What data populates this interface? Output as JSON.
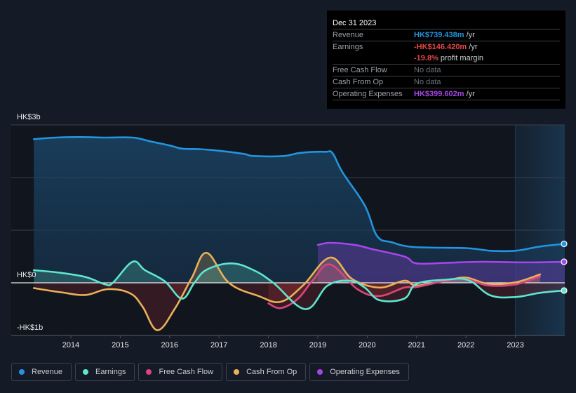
{
  "tooltip": {
    "date": "Dec 31 2023",
    "rows": [
      {
        "label": "Revenue",
        "value": "HK$739.438m",
        "suffix": " /yr",
        "color": "#2394df"
      },
      {
        "label": "Earnings",
        "value": "-HK$146.420m",
        "suffix": " /yr",
        "color": "#e64747"
      },
      {
        "label": "",
        "value": "-19.8%",
        "suffix": " profit margin",
        "color": "#e64747"
      },
      {
        "label": "Free Cash Flow",
        "value": "No data",
        "suffix": "",
        "color": ""
      },
      {
        "label": "Cash From Op",
        "value": "No data",
        "suffix": "",
        "color": ""
      },
      {
        "label": "Operating Expenses",
        "value": "HK$399.602m",
        "suffix": " /yr",
        "color": "#a646e8"
      }
    ]
  },
  "legend": [
    {
      "label": "Revenue",
      "color": "#2394df"
    },
    {
      "label": "Earnings",
      "color": "#5ee6cf"
    },
    {
      "label": "Free Cash Flow",
      "color": "#d8457f"
    },
    {
      "label": "Cash From Op",
      "color": "#eab05a"
    },
    {
      "label": "Operating Expenses",
      "color": "#a646e8"
    }
  ],
  "chart_data": {
    "type": "line",
    "title": "",
    "xlabel": "",
    "ylabel": "",
    "currency": "HK$",
    "y_unit": "billions",
    "ylim": [
      -1,
      3
    ],
    "y_ticks": [
      {
        "value": 3,
        "label": "HK$3b"
      },
      {
        "value": 0,
        "label": "HK$0"
      },
      {
        "value": -1,
        "label": "-HK$1b"
      }
    ],
    "y_gridlines": [
      3,
      2,
      1,
      0
    ],
    "xlim": [
      2012.35,
      2024.0
    ],
    "x_ticks": [
      "2014",
      "2015",
      "2016",
      "2017",
      "2018",
      "2019",
      "2020",
      "2021",
      "2022",
      "2023"
    ],
    "highlight_region": [
      2023.0,
      2024.0
    ],
    "legend_position": "bottom-left",
    "series": [
      {
        "name": "Revenue",
        "color": "#2394df",
        "fill": "area",
        "end_marker": true,
        "points": [
          [
            2013.25,
            2.73
          ],
          [
            2013.7,
            2.76
          ],
          [
            2014.2,
            2.77
          ],
          [
            2014.7,
            2.76
          ],
          [
            2015.25,
            2.76
          ],
          [
            2015.6,
            2.69
          ],
          [
            2016.0,
            2.61
          ],
          [
            2016.25,
            2.55
          ],
          [
            2016.6,
            2.54
          ],
          [
            2017.0,
            2.51
          ],
          [
            2017.5,
            2.45
          ],
          [
            2017.7,
            2.41
          ],
          [
            2018.3,
            2.41
          ],
          [
            2018.65,
            2.47
          ],
          [
            2019.15,
            2.49
          ],
          [
            2019.3,
            2.46
          ],
          [
            2019.5,
            2.1
          ],
          [
            2019.95,
            1.47
          ],
          [
            2020.2,
            0.89
          ],
          [
            2020.5,
            0.77
          ],
          [
            2020.95,
            0.68
          ],
          [
            2022.0,
            0.66
          ],
          [
            2022.5,
            0.61
          ],
          [
            2023.0,
            0.61
          ],
          [
            2023.5,
            0.69
          ],
          [
            2024.0,
            0.74
          ]
        ]
      },
      {
        "name": "Earnings",
        "color": "#5ee6cf",
        "fill": "zero",
        "end_marker": true,
        "points": [
          [
            2013.25,
            0.24
          ],
          [
            2013.8,
            0.19
          ],
          [
            2014.3,
            0.11
          ],
          [
            2014.7,
            -0.03
          ],
          [
            2014.85,
            0.0
          ],
          [
            2015.25,
            0.4
          ],
          [
            2015.5,
            0.24
          ],
          [
            2015.9,
            0.03
          ],
          [
            2016.25,
            -0.3
          ],
          [
            2016.5,
            0.0
          ],
          [
            2016.75,
            0.25
          ],
          [
            2017.25,
            0.37
          ],
          [
            2017.7,
            0.24
          ],
          [
            2018.1,
            0.0
          ],
          [
            2018.75,
            -0.5
          ],
          [
            2019.2,
            -0.05
          ],
          [
            2019.65,
            0.04
          ],
          [
            2019.95,
            -0.09
          ],
          [
            2020.25,
            -0.33
          ],
          [
            2020.75,
            -0.3
          ],
          [
            2021.0,
            -0.02
          ],
          [
            2021.6,
            0.06
          ],
          [
            2022.05,
            0.05
          ],
          [
            2022.5,
            -0.24
          ],
          [
            2023.0,
            -0.27
          ],
          [
            2023.5,
            -0.19
          ],
          [
            2024.0,
            -0.146
          ]
        ]
      },
      {
        "name": "Free Cash Flow",
        "color": "#d8457f",
        "fill": "zero",
        "end_marker": false,
        "points": [
          [
            2018.0,
            -0.39
          ],
          [
            2018.25,
            -0.48
          ],
          [
            2018.6,
            -0.3
          ],
          [
            2018.9,
            0.05
          ],
          [
            2019.25,
            0.35
          ],
          [
            2019.8,
            -0.12
          ],
          [
            2020.25,
            -0.25
          ],
          [
            2020.75,
            -0.09
          ],
          [
            2021.0,
            -0.08
          ],
          [
            2021.6,
            0.04
          ],
          [
            2022.0,
            0.07
          ],
          [
            2022.45,
            -0.05
          ],
          [
            2023.0,
            -0.03
          ],
          [
            2023.5,
            0.12
          ]
        ]
      },
      {
        "name": "Cash From Op",
        "color": "#eab05a",
        "fill": "zero",
        "end_marker": false,
        "points": [
          [
            2013.25,
            -0.1
          ],
          [
            2013.8,
            -0.18
          ],
          [
            2014.3,
            -0.23
          ],
          [
            2014.75,
            -0.12
          ],
          [
            2015.2,
            -0.2
          ],
          [
            2015.45,
            -0.45
          ],
          [
            2015.75,
            -0.9
          ],
          [
            2016.1,
            -0.5
          ],
          [
            2016.45,
            0.1
          ],
          [
            2016.75,
            0.57
          ],
          [
            2017.2,
            0.0
          ],
          [
            2017.8,
            -0.25
          ],
          [
            2018.25,
            -0.36
          ],
          [
            2018.7,
            -0.05
          ],
          [
            2019.25,
            0.48
          ],
          [
            2019.7,
            0.07
          ],
          [
            2020.25,
            -0.09
          ],
          [
            2020.75,
            0.04
          ],
          [
            2021.0,
            -0.05
          ],
          [
            2021.6,
            0.04
          ],
          [
            2022.0,
            0.1
          ],
          [
            2022.45,
            -0.02
          ],
          [
            2023.0,
            0.01
          ],
          [
            2023.5,
            0.16
          ]
        ]
      },
      {
        "name": "Operating Expenses",
        "color": "#a646e8",
        "fill": "zero",
        "end_marker": true,
        "points": [
          [
            2019.0,
            0.72
          ],
          [
            2019.25,
            0.76
          ],
          [
            2019.75,
            0.72
          ],
          [
            2020.1,
            0.64
          ],
          [
            2020.75,
            0.5
          ],
          [
            2021.0,
            0.37
          ],
          [
            2021.6,
            0.38
          ],
          [
            2022.3,
            0.4
          ],
          [
            2023.0,
            0.39
          ],
          [
            2023.5,
            0.39
          ],
          [
            2024.0,
            0.4
          ]
        ]
      }
    ]
  }
}
